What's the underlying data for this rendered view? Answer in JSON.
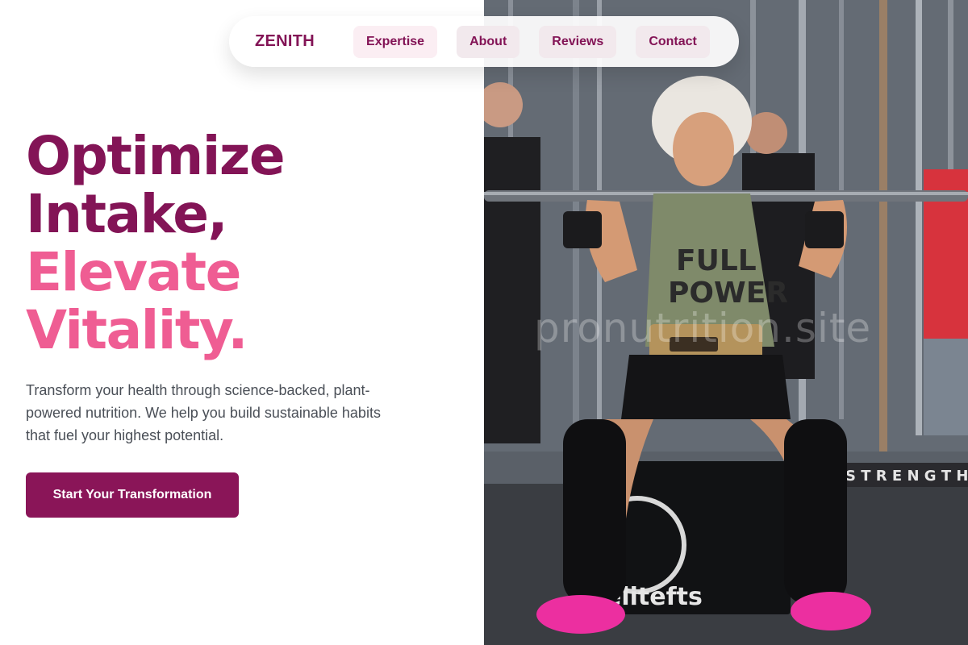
{
  "nav": {
    "brand": "ZENITH",
    "links": [
      "Expertise",
      "About",
      "Reviews",
      "Contact"
    ]
  },
  "hero": {
    "line1": "Optimize",
    "line2": "Intake,",
    "line3": "Elevate",
    "line4": "Vitality.",
    "subtitle": "Transform your health through science-backed, plant-powered nutrition. We help you build sustainable habits that fuel your highest potential.",
    "cta": "Start Your Transformation"
  },
  "image": {
    "shirt_line1": "FULL",
    "shirt_line2": "POWER",
    "box_logo": "elitefts",
    "watermark": "pronutrition.site",
    "banner": "S T R E N G T H"
  },
  "colors": {
    "brand": "#831456",
    "accent": "#ef5d93",
    "button": "#8a1558"
  }
}
